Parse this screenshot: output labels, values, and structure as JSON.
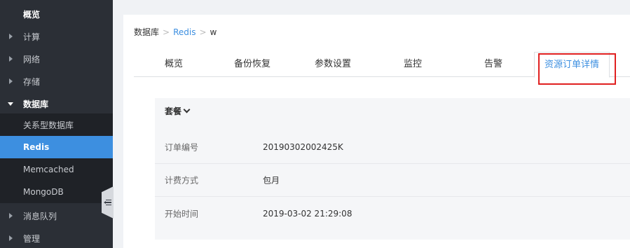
{
  "sidebar": {
    "overview": "概览",
    "compute": "计算",
    "network": "网络",
    "storage": "存储",
    "database": "数据库",
    "db_items": [
      "关系型数据库",
      "Redis",
      "Memcached",
      "MongoDB"
    ],
    "mq": "消息队列",
    "manage": "管理"
  },
  "breadcrumb": {
    "root": "数据库",
    "sep": ">",
    "service": "Redis",
    "instance": "w"
  },
  "tabs": [
    "概览",
    "备份恢复",
    "参数设置",
    "监控",
    "告警",
    "资源订单详情"
  ],
  "active_tab": "资源订单详情",
  "panel": {
    "title": "套餐",
    "rows": [
      {
        "key": "订单编号",
        "value": "20190302002425K"
      },
      {
        "key": "计费方式",
        "value": "包月"
      },
      {
        "key": "开始时间",
        "value": "2019-03-02 21:29:08"
      }
    ]
  },
  "colors": {
    "accent": "#3d8fe0",
    "highlight": "#e02020",
    "sidebar_bg": "#2b2f36"
  }
}
